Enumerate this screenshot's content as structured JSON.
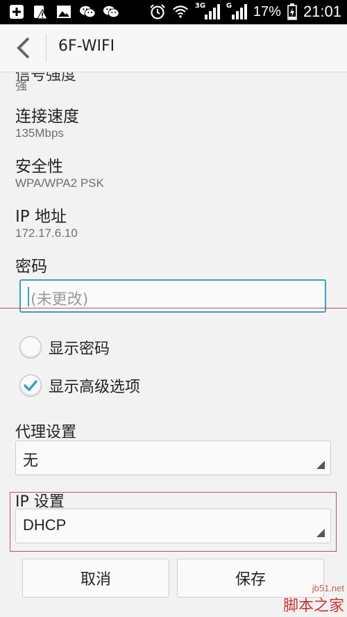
{
  "status_bar": {
    "icons": [
      "add-icon",
      "warning-icon",
      "image-icon",
      "wechat-icon",
      "wechat-icon",
      "alarm-icon",
      "wifi-icon",
      "signal-3g-icon",
      "signal-g-icon",
      "battery-charging-icon"
    ],
    "network_3g": "3G",
    "network_g": "G",
    "battery": "17%",
    "time": "21:01"
  },
  "action_bar": {
    "title": "6F-WIFI"
  },
  "details": {
    "signal_value": "强",
    "speed_label": "连接速度",
    "speed_value": "135Mbps",
    "security_label": "安全性",
    "security_value": "WPA/WPA2 PSK",
    "ip_label": "IP 地址",
    "ip_value": "172.17.6.10"
  },
  "password": {
    "label": "密码",
    "placeholder": "(未更改)"
  },
  "options": {
    "show_password": {
      "label": "显示密码",
      "checked": false
    },
    "show_advanced": {
      "label": "显示高级选项",
      "checked": true
    }
  },
  "proxy": {
    "label": "代理设置",
    "value": "无"
  },
  "ip_settings": {
    "label": "IP 设置",
    "value": "DHCP"
  },
  "buttons": {
    "cancel": "取消",
    "save": "保存"
  },
  "watermark": {
    "top": "jb51.net",
    "bottom": "脚本之家"
  },
  "colors": {
    "accent": "#3aa1b8",
    "annotation": "#c05050"
  }
}
